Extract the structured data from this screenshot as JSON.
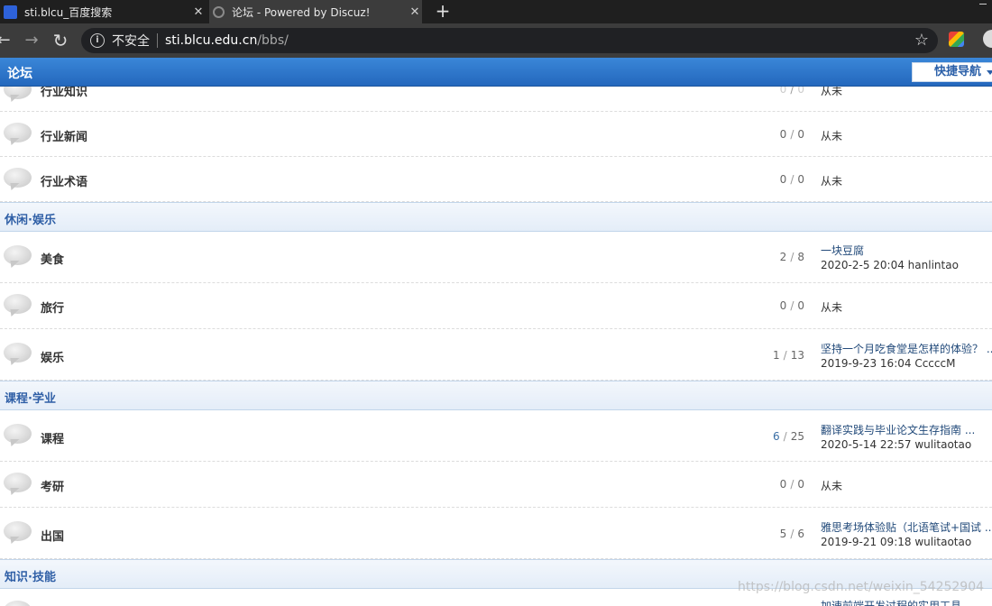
{
  "browser": {
    "tabs": [
      {
        "title": "sti.blcu_百度搜索",
        "close": "✕"
      },
      {
        "title": "论坛 - Powered by Discuz!",
        "close": "✕"
      }
    ],
    "new_tab": "+",
    "nav": {
      "back": "←",
      "forward": "→",
      "reload": "↻"
    },
    "address": {
      "security_label": "不安全",
      "host": "sti.blcu.edu.cn",
      "path": "/bbs/"
    },
    "bookmark_star": "☆"
  },
  "header": {
    "logo": "论坛",
    "quick_nav": "快捷导航"
  },
  "forums": [
    {
      "name": "行业知识",
      "threads": "0",
      "posts": "0",
      "last_never": "从未"
    },
    {
      "name": "行业新闻",
      "threads": "0",
      "posts": "0",
      "last_never": "从未"
    },
    {
      "name": "行业术语",
      "threads": "0",
      "posts": "0",
      "last_never": "从未"
    },
    {
      "name": "美食",
      "threads": "2",
      "posts": "8",
      "last_title": "一块豆腐",
      "last_meta": "2020-2-5 20:04 hanlintao"
    },
    {
      "name": "旅行",
      "threads": "0",
      "posts": "0",
      "last_never": "从未"
    },
    {
      "name": "娱乐",
      "threads": "1",
      "posts": "13",
      "last_title": "坚持一个月吃食堂是怎样的体验？ ...",
      "last_meta": "2019-9-23 16:04 CccccM"
    },
    {
      "name": "课程",
      "threads": "6",
      "posts": "25",
      "last_title": "翻译实践与毕业论文生存指南 ...",
      "last_meta": "2020-5-14 22:57 wulitaotao"
    },
    {
      "name": "考研",
      "threads": "0",
      "posts": "0",
      "last_never": "从未"
    },
    {
      "name": "出国",
      "threads": "5",
      "posts": "6",
      "last_title": "雅思考场体验贴（北语笔试+国试 ...",
      "last_meta": "2019-9-21 09:18 wulitaotao"
    },
    {
      "name": "",
      "threads": "",
      "posts": "",
      "last_title": "加速前端开发过程的实用工具"
    }
  ],
  "categories": [
    "休闲·娱乐",
    "课程·学业",
    "知识·技能"
  ],
  "watermark": "https://blog.csdn.net/weixin_54252904"
}
